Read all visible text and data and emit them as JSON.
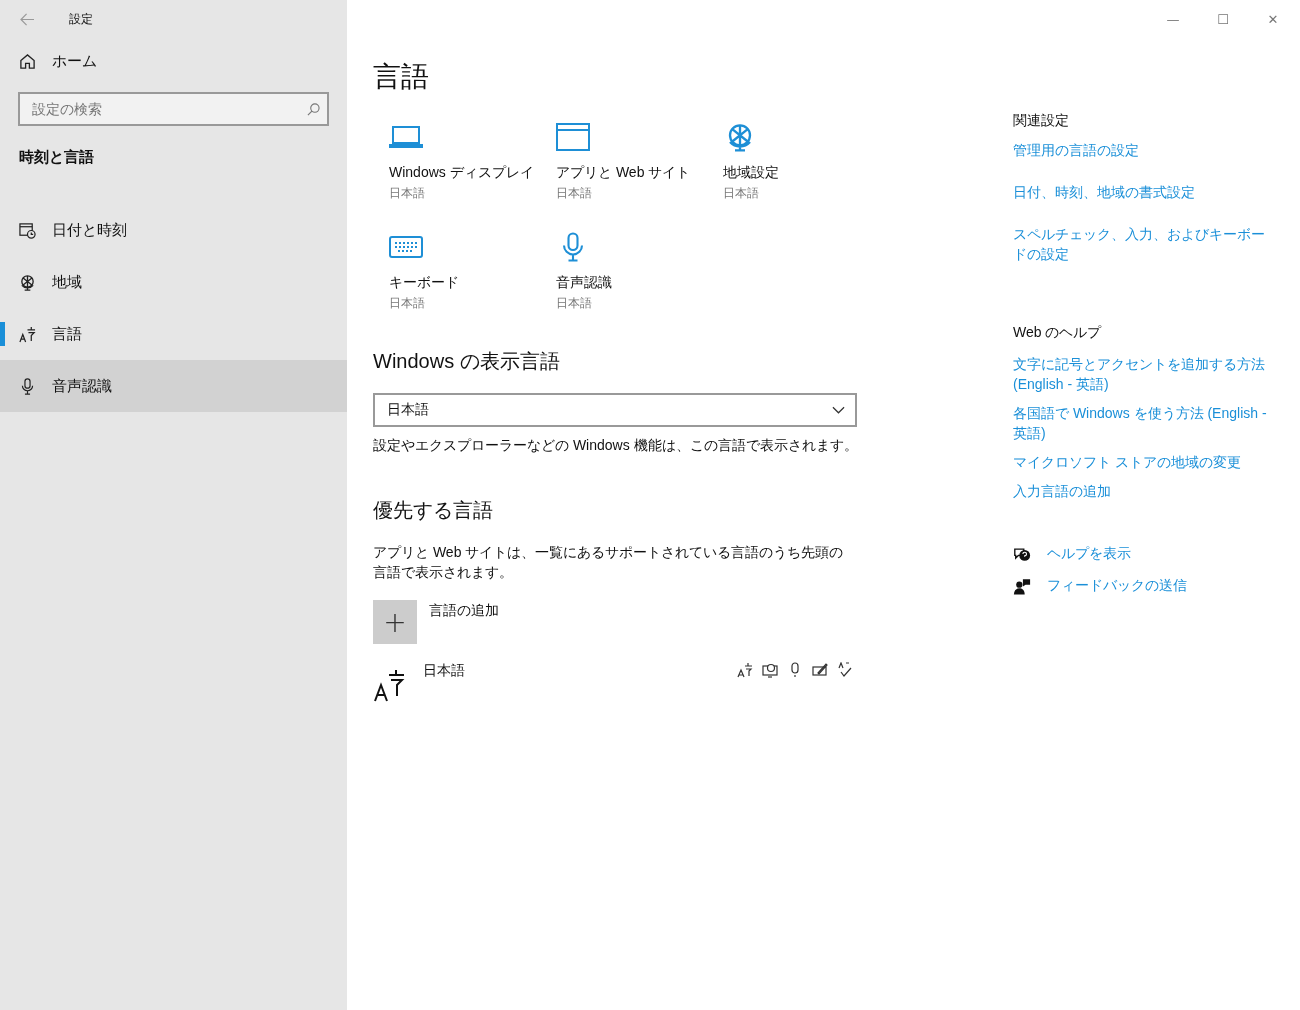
{
  "window": {
    "title": "設定",
    "controls": [
      "—",
      "☐",
      "✕"
    ]
  },
  "sidebar": {
    "home": "ホーム",
    "search": {
      "placeholder": "設定の検索"
    },
    "section": "時刻と言語",
    "items": [
      {
        "kind": "calendar",
        "label": "日付と時刻",
        "selected": false,
        "hovered": false
      },
      {
        "kind": "globe",
        "label": "地域",
        "selected": false,
        "hovered": false
      },
      {
        "kind": "language",
        "label": "言語",
        "selected": true,
        "hovered": false
      },
      {
        "kind": "mic",
        "label": "音声認識",
        "selected": false,
        "hovered": true
      }
    ]
  },
  "main": {
    "title": "言語",
    "tiles": [
      {
        "kind": "laptop",
        "label": "Windows ディスプレイ",
        "value": "日本語"
      },
      {
        "kind": "window",
        "label": "アプリと Web サイト",
        "value": "日本語"
      },
      {
        "kind": "globe",
        "label": "地域設定",
        "value": "日本語"
      },
      {
        "kind": "keyboard",
        "label": "キーボード",
        "value": "日本語"
      },
      {
        "kind": "mic",
        "label": "音声認識",
        "value": "日本語"
      }
    ],
    "display_language": {
      "heading": "Windows の表示言語",
      "value": "日本語",
      "note": "設定やエクスプローラーなどの Windows 機能は、この言語で表示されます。"
    },
    "preferred": {
      "heading": "優先する言語",
      "note": "アプリと Web サイトは、一覧にあるサポートされている言語のうち先頭の言語で表示されます。",
      "add": {
        "icon": "+",
        "label": "言語の追加"
      },
      "languages": [
        {
          "name": "日本語"
        }
      ]
    }
  },
  "related": {
    "heading": "関連設定",
    "links": [
      "管理用の言語の設定",
      "日付、時刻、地域の書式設定",
      "スペルチェック、入力、およびキーボードの設定"
    ],
    "help_heading": "Web のヘルプ",
    "help_links": [
      "文字に記号とアクセントを追加する方法 (English - 英語)",
      "各国語で Windows を使う方法 (English - 英語)",
      "マイクロソフト ストアの地域の変更",
      "入力言語の追加"
    ],
    "actions": [
      {
        "kind": "help",
        "label": "ヘルプを表示"
      },
      {
        "kind": "feedback",
        "label": "フィードバックの送信"
      }
    ]
  }
}
